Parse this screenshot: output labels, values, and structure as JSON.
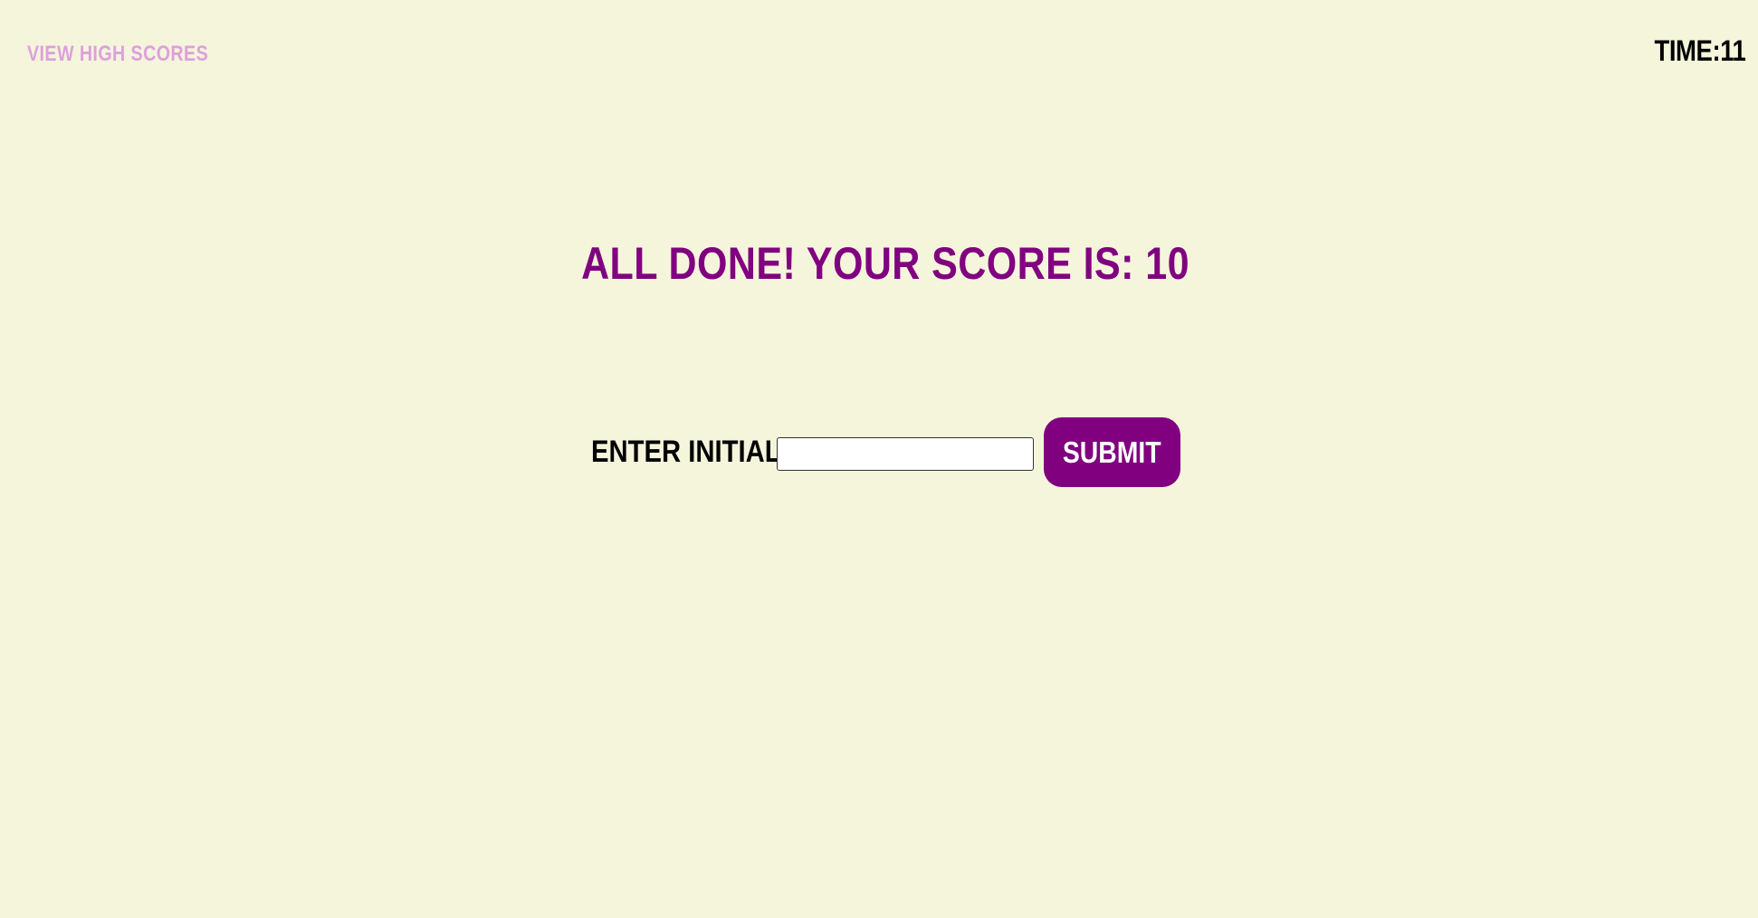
{
  "header": {
    "high_scores_link": "View High Scores",
    "timer_label": "Time:",
    "timer_value": "11"
  },
  "main": {
    "heading": "All Done! Your score is: 10",
    "initials_label": "Enter Initials:",
    "initials_value": "",
    "submit_label": "Submit"
  },
  "colors": {
    "background": "#f5f5dc",
    "accent": "#800080",
    "link": "#dda0dd"
  }
}
